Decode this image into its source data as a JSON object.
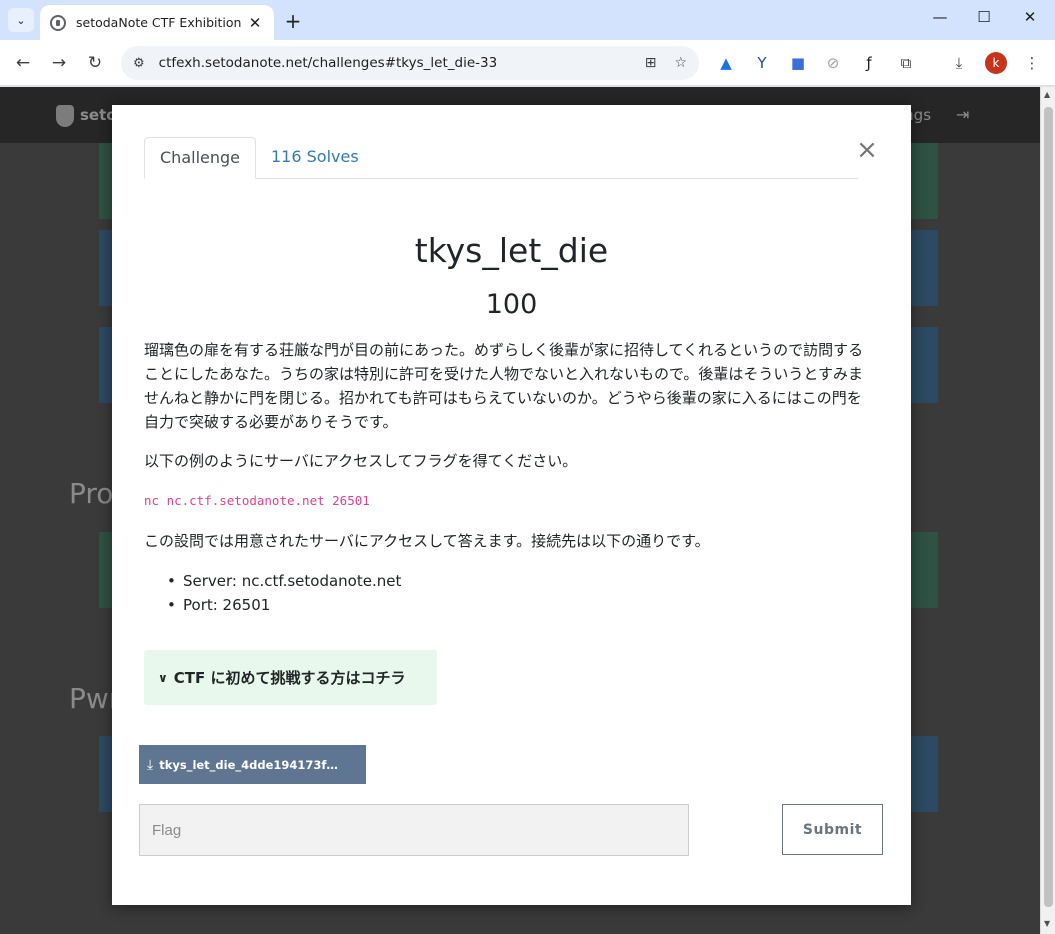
{
  "browser": {
    "tab_title": "setodaNote CTF Exhibition",
    "url": "ctfexh.setodanote.net/challenges#tkys_let_die-33",
    "profile_initial": "k",
    "icons": [
      "tab-search-icon",
      "favicon-icon",
      "close-icon",
      "new-tab-icon",
      "minimize-icon",
      "maximize-icon",
      "window-close-icon",
      "back-icon",
      "forward-icon",
      "reload-icon",
      "site-info-icon",
      "translate-icon",
      "bookmark-star-icon",
      "google-drive-icon",
      "extension-icon",
      "download-icon",
      "menu-icon"
    ]
  },
  "background_page": {
    "brand": "seto",
    "nav_right": "ings",
    "categories": [
      "Pro",
      "Pwı"
    ],
    "card_colors": [
      "#2f6e4a",
      "#2c4a63"
    ]
  },
  "modal": {
    "tabs": [
      "Challenge",
      "116 Solves"
    ],
    "name": "tkys_let_die",
    "value": "100",
    "description": [
      "瑠璃色の扉を有する荘厳な門が目の前にあった。めずらしく後輩が家に招待してくれるというので訪問することにしたあなた。うちの家は特別に許可を受けた人物でないと入れないもので。後輩はそういうとすみませんねと静かに門を閉じる。招かれても許可はもらえていないのか。どうやら後輩の家に入るにはこの門を自力で突破する必要がありそうです。",
      "以下の例のようにサーバにアクセスしてフラグを得てください。",
      "この設問では用意されたサーバにアクセスして答えます。接続先は以下の通りです。"
    ],
    "code": "nc nc.ctf.setodanote.net 26501",
    "servers": [
      "Server: nc.ctf.setodanote.net",
      "Port: 26501"
    ],
    "help_label": "CTF に初めて挑戦する方はコチラ",
    "file_label": "tkys_let_die_4dde194173f…",
    "flag_placeholder": "Flag",
    "submit_label": "Submit"
  }
}
